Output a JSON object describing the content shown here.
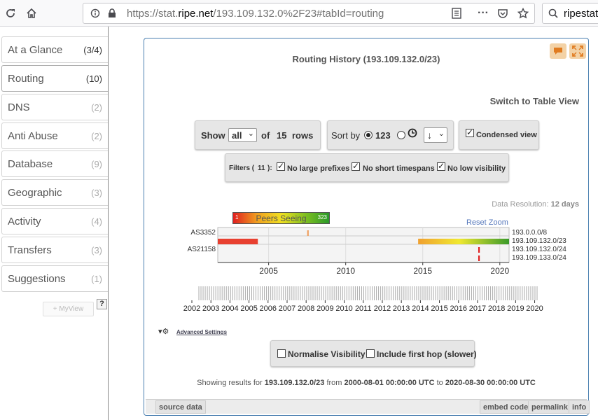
{
  "browser": {
    "url_prefix": "https://stat.",
    "url_host": "ripe.net",
    "url_rest": "/193.109.132.0%2F23#tabId=routing",
    "search_text": "ripestat"
  },
  "sidebar": {
    "items": [
      {
        "label": "At a Glance",
        "count": "(3/4)"
      },
      {
        "label": "Routing",
        "count": "(10)"
      },
      {
        "label": "DNS",
        "count": "(2)"
      },
      {
        "label": "Anti Abuse",
        "count": "(2)"
      },
      {
        "label": "Database",
        "count": "(9)"
      },
      {
        "label": "Geographic",
        "count": "(3)"
      },
      {
        "label": "Activity",
        "count": "(4)"
      },
      {
        "label": "Transfers",
        "count": "(3)"
      },
      {
        "label": "Suggestions",
        "count": "(1)"
      }
    ],
    "myview_label": "+ MyView",
    "help_label": "?"
  },
  "widget": {
    "title": "Routing History (193.109.132.0/23)",
    "switch_view": "Switch to Table View",
    "show_label": "Show",
    "show_value": "all",
    "of_label": "of",
    "rows_count": "15",
    "rows_label": "rows",
    "sort_label": "Sort by",
    "sort_numeric": "123",
    "sort_order": "↓",
    "condensed_label": "Condensed view",
    "filters_label": "Filters (",
    "filters_count": "11",
    "filters_close": "):",
    "filter_1": "No large prefixes",
    "filter_2": "No short timespans",
    "filter_3": "No low visibility",
    "resolution_label": "Data Resolution:",
    "resolution_value": "12 days",
    "legend_low": "1",
    "legend_mid": "Peers Seeing",
    "legend_high": "323",
    "reset_zoom": "Reset Zoom",
    "advanced_settings": "Advanced Settings",
    "normalise_label": "Normalise Visibility",
    "first_hop_label": "Include first hop (slower)",
    "footer_prefix": "Showing results for",
    "footer_prefix_value": "193.109.132.0/23",
    "footer_from": "from",
    "footer_from_value": "2000-08-01 00:00:00 UTC",
    "footer_to": "to",
    "footer_to_value": "2020-08-30 00:00:00 UTC",
    "bottom_source": "source data",
    "bottom_embed": "embed code",
    "bottom_permalink": "permalink",
    "bottom_info": "info"
  },
  "chart_data": {
    "type": "timeline",
    "y_left_labels": [
      "AS3352",
      "AS21158"
    ],
    "y_right_labels": [
      "193.0.0.0/8",
      "193.109.132.0/23",
      "193.109.132.0/24",
      "193.109.133.0/24"
    ],
    "x_ticks": [
      2005,
      2010,
      2015,
      2020
    ],
    "x_range": [
      2001.7,
      2020.6
    ],
    "overview_ticks": [
      2002,
      2003,
      2004,
      2005,
      2006,
      2007,
      2008,
      2009,
      2010,
      2011,
      2012,
      2013,
      2014,
      2015,
      2016,
      2017,
      2018,
      2019,
      2020
    ],
    "rows": [
      {
        "segments": [
          {
            "from": 2007.5,
            "to": 2007.6,
            "color": "#f0a060"
          }
        ]
      },
      {
        "segments": [
          {
            "from": 2001.7,
            "to": 2004.3,
            "color": "#e84030"
          },
          {
            "from": 2014.7,
            "to": 2020.6,
            "color": "gradient"
          }
        ]
      },
      {
        "segments": [
          {
            "from": 2018.6,
            "to": 2018.7,
            "color": "#e02020"
          }
        ]
      },
      {
        "segments": [
          {
            "from": 2018.6,
            "to": 2018.7,
            "color": "#e02020"
          }
        ]
      }
    ]
  }
}
